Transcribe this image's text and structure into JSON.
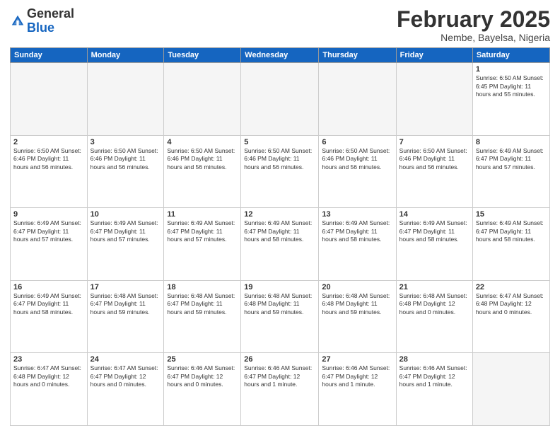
{
  "header": {
    "logo_general": "General",
    "logo_blue": "Blue",
    "month_title": "February 2025",
    "subtitle": "Nembe, Bayelsa, Nigeria"
  },
  "days_of_week": [
    "Sunday",
    "Monday",
    "Tuesday",
    "Wednesday",
    "Thursday",
    "Friday",
    "Saturday"
  ],
  "weeks": [
    [
      {
        "day": "",
        "info": ""
      },
      {
        "day": "",
        "info": ""
      },
      {
        "day": "",
        "info": ""
      },
      {
        "day": "",
        "info": ""
      },
      {
        "day": "",
        "info": ""
      },
      {
        "day": "",
        "info": ""
      },
      {
        "day": "1",
        "info": "Sunrise: 6:50 AM\nSunset: 6:45 PM\nDaylight: 11 hours\nand 55 minutes."
      }
    ],
    [
      {
        "day": "2",
        "info": "Sunrise: 6:50 AM\nSunset: 6:46 PM\nDaylight: 11 hours\nand 56 minutes."
      },
      {
        "day": "3",
        "info": "Sunrise: 6:50 AM\nSunset: 6:46 PM\nDaylight: 11 hours\nand 56 minutes."
      },
      {
        "day": "4",
        "info": "Sunrise: 6:50 AM\nSunset: 6:46 PM\nDaylight: 11 hours\nand 56 minutes."
      },
      {
        "day": "5",
        "info": "Sunrise: 6:50 AM\nSunset: 6:46 PM\nDaylight: 11 hours\nand 56 minutes."
      },
      {
        "day": "6",
        "info": "Sunrise: 6:50 AM\nSunset: 6:46 PM\nDaylight: 11 hours\nand 56 minutes."
      },
      {
        "day": "7",
        "info": "Sunrise: 6:50 AM\nSunset: 6:46 PM\nDaylight: 11 hours\nand 56 minutes."
      },
      {
        "day": "8",
        "info": "Sunrise: 6:49 AM\nSunset: 6:47 PM\nDaylight: 11 hours\nand 57 minutes."
      }
    ],
    [
      {
        "day": "9",
        "info": "Sunrise: 6:49 AM\nSunset: 6:47 PM\nDaylight: 11 hours\nand 57 minutes."
      },
      {
        "day": "10",
        "info": "Sunrise: 6:49 AM\nSunset: 6:47 PM\nDaylight: 11 hours\nand 57 minutes."
      },
      {
        "day": "11",
        "info": "Sunrise: 6:49 AM\nSunset: 6:47 PM\nDaylight: 11 hours\nand 57 minutes."
      },
      {
        "day": "12",
        "info": "Sunrise: 6:49 AM\nSunset: 6:47 PM\nDaylight: 11 hours\nand 58 minutes."
      },
      {
        "day": "13",
        "info": "Sunrise: 6:49 AM\nSunset: 6:47 PM\nDaylight: 11 hours\nand 58 minutes."
      },
      {
        "day": "14",
        "info": "Sunrise: 6:49 AM\nSunset: 6:47 PM\nDaylight: 11 hours\nand 58 minutes."
      },
      {
        "day": "15",
        "info": "Sunrise: 6:49 AM\nSunset: 6:47 PM\nDaylight: 11 hours\nand 58 minutes."
      }
    ],
    [
      {
        "day": "16",
        "info": "Sunrise: 6:49 AM\nSunset: 6:47 PM\nDaylight: 11 hours\nand 58 minutes."
      },
      {
        "day": "17",
        "info": "Sunrise: 6:48 AM\nSunset: 6:47 PM\nDaylight: 11 hours\nand 59 minutes."
      },
      {
        "day": "18",
        "info": "Sunrise: 6:48 AM\nSunset: 6:47 PM\nDaylight: 11 hours\nand 59 minutes."
      },
      {
        "day": "19",
        "info": "Sunrise: 6:48 AM\nSunset: 6:48 PM\nDaylight: 11 hours\nand 59 minutes."
      },
      {
        "day": "20",
        "info": "Sunrise: 6:48 AM\nSunset: 6:48 PM\nDaylight: 11 hours\nand 59 minutes."
      },
      {
        "day": "21",
        "info": "Sunrise: 6:48 AM\nSunset: 6:48 PM\nDaylight: 12 hours\nand 0 minutes."
      },
      {
        "day": "22",
        "info": "Sunrise: 6:47 AM\nSunset: 6:48 PM\nDaylight: 12 hours\nand 0 minutes."
      }
    ],
    [
      {
        "day": "23",
        "info": "Sunrise: 6:47 AM\nSunset: 6:48 PM\nDaylight: 12 hours\nand 0 minutes."
      },
      {
        "day": "24",
        "info": "Sunrise: 6:47 AM\nSunset: 6:47 PM\nDaylight: 12 hours\nand 0 minutes."
      },
      {
        "day": "25",
        "info": "Sunrise: 6:46 AM\nSunset: 6:47 PM\nDaylight: 12 hours\nand 0 minutes."
      },
      {
        "day": "26",
        "info": "Sunrise: 6:46 AM\nSunset: 6:47 PM\nDaylight: 12 hours\nand 1 minute."
      },
      {
        "day": "27",
        "info": "Sunrise: 6:46 AM\nSunset: 6:47 PM\nDaylight: 12 hours\nand 1 minute."
      },
      {
        "day": "28",
        "info": "Sunrise: 6:46 AM\nSunset: 6:47 PM\nDaylight: 12 hours\nand 1 minute."
      },
      {
        "day": "",
        "info": ""
      }
    ]
  ]
}
